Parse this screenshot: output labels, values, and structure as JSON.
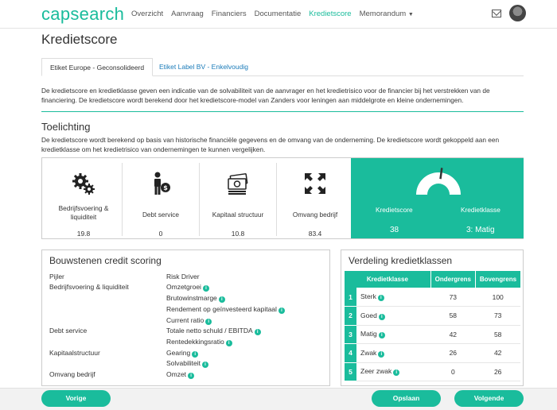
{
  "brand": "capsearch",
  "nav": {
    "items": [
      "Overzicht",
      "Aanvraag",
      "Financiers",
      "Documentatie",
      "Kredietscore",
      "Memorandum"
    ],
    "active": "Kredietscore"
  },
  "page_title": "Kredietscore",
  "tabs": [
    "Etiket Europe - Geconsolideerd",
    "Etiket Label BV - Enkelvoudig"
  ],
  "intro": "De kredietscore en kredietklasse geven een indicatie van de solvabiliteit van de aanvrager en het kredietrisico voor de financier bij het verstrekken van de financiering. De kredietscore wordt berekend door het kredietscore-model van Zanders voor leningen aan middelgrote en kleine ondernemingen.",
  "toelichting": {
    "title": "Toelichting",
    "text": "De kredietscore wordt berekend op basis van historische financiële gegevens en de omvang van de onderneming. De kredietscore wordt gekoppeld aan een kredietklasse om het kredietrisico van ondernemingen te kunnen vergelijken."
  },
  "metrics": [
    {
      "label": "Bedrijfsvoering & liquiditeit",
      "value": "19.8",
      "icon": "gears-icon"
    },
    {
      "label": "Debt service",
      "value": "0",
      "icon": "person-coin-icon"
    },
    {
      "label": "Kapitaal structuur",
      "value": "10.8",
      "icon": "money-stack-icon"
    },
    {
      "label": "Omvang bedrijf",
      "value": "83.4",
      "icon": "expand-icon"
    }
  ],
  "score": {
    "score_label": "Kredietscore",
    "score_value": "38",
    "class_label": "Kredietklasse",
    "class_value": "3: Matig",
    "gauge_fraction": 0.38
  },
  "bouwstenen": {
    "title": "Bouwstenen credit scoring",
    "col_pijler": "Pijler",
    "col_driver": "Risk Driver",
    "pijlers": [
      "Bedrijfsvoering & liquiditeit",
      "Debt service",
      "Kapitaalstructuur",
      "Omvang bedrijf"
    ],
    "drivers": [
      "Omzetgroei",
      "Brutowinstmarge",
      "Rendement op geïnvesteerd kapitaal",
      "Current ratio",
      "Totale netto schuld / EBITDA",
      "Rentedekkingsratio",
      "Gearing",
      "Solvabiliteit",
      "Omzet"
    ]
  },
  "verdeling": {
    "title": "Verdeling kredietklassen",
    "headers": [
      "Kredietklasse",
      "Ondergrens",
      "Bovengrens"
    ],
    "rows": [
      {
        "num": "1",
        "name": "Sterk",
        "onder": "73",
        "boven": "100"
      },
      {
        "num": "2",
        "name": "Goed",
        "onder": "58",
        "boven": "73"
      },
      {
        "num": "3",
        "name": "Matig",
        "onder": "42",
        "boven": "58"
      },
      {
        "num": "4",
        "name": "Zwak",
        "onder": "26",
        "boven": "42"
      },
      {
        "num": "5",
        "name": "Zeer zwak",
        "onder": "0",
        "boven": "26"
      }
    ]
  },
  "footer": {
    "prev": "Vorige",
    "save": "Opslaan",
    "next": "Volgende"
  },
  "colors": {
    "accent": "#1abc9c",
    "link": "#1a7bb9"
  }
}
